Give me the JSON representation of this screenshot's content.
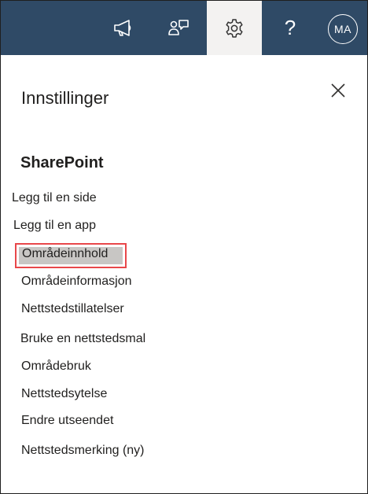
{
  "topbar": {
    "icons": [
      "megaphone-icon",
      "feedback-icon",
      "gear-icon",
      "help-icon"
    ],
    "help_label": "?",
    "avatar_initials": "MA"
  },
  "panel": {
    "title": "Innstillinger",
    "close_icon": "close-icon",
    "section_title": "SharePoint",
    "items": [
      {
        "label": "Legg til en side"
      },
      {
        "label": "Legg til en app"
      },
      {
        "label": "Områdeinnhold",
        "highlighted": true
      },
      {
        "label": "Områdeinformasjon"
      },
      {
        "label": "Nettstedstillatelser"
      },
      {
        "label": "Bruke en nettstedsmal"
      },
      {
        "label": "Områdebruk"
      },
      {
        "label": "Nettstedsytelse"
      },
      {
        "label": "Endre utseendet"
      },
      {
        "label": "Nettstedsmerking (ny)"
      }
    ]
  },
  "colors": {
    "topbar": "#2f4a66",
    "active_tab": "#f3f2f1",
    "highlight_border": "#e8474a",
    "highlight_fill": "#c8c6c4"
  }
}
